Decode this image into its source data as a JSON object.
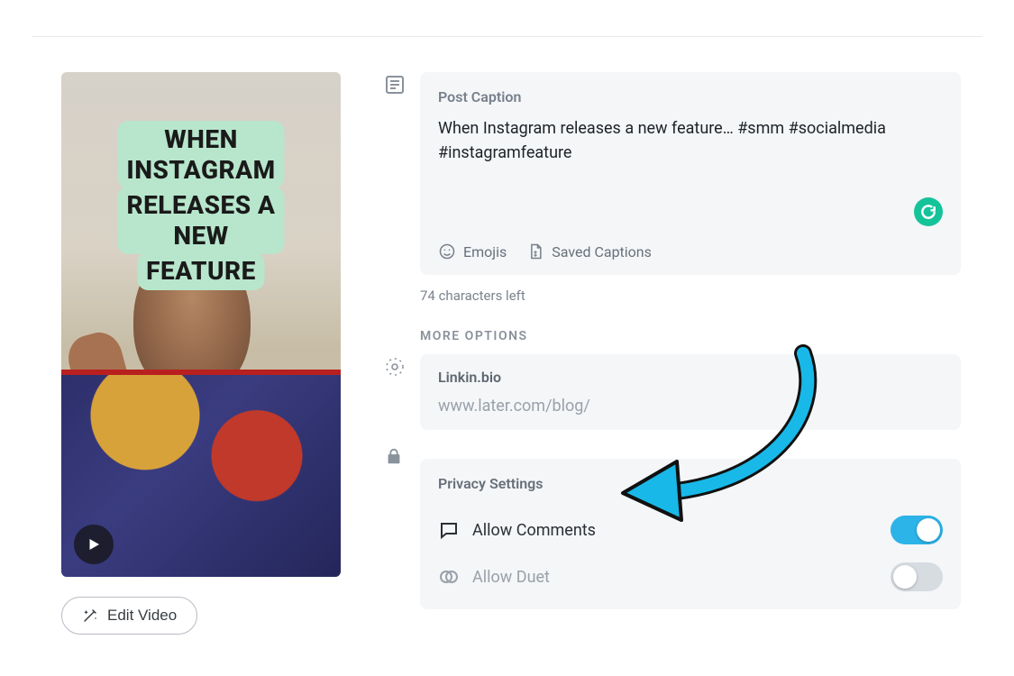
{
  "video": {
    "overlay_line1": "WHEN INSTAGRAM",
    "overlay_line2": "RELEASES A NEW",
    "overlay_line3": "FEATURE",
    "edit_button": "Edit Video"
  },
  "caption": {
    "label": "Post Caption",
    "text": "When Instagram releases a new feature… #smm #socialmedia #instagramfeature",
    "emojis": "Emojis",
    "saved": "Saved Captions",
    "chars_left": "74 characters left"
  },
  "more_options_header": "MORE OPTIONS",
  "linkinbio": {
    "label": "Linkin.bio",
    "url": "www.later.com/blog/"
  },
  "privacy": {
    "label": "Privacy Settings",
    "allow_comments": {
      "label": "Allow Comments",
      "on": true
    },
    "allow_duet": {
      "label": "Allow Duet",
      "on": false
    }
  },
  "colors": {
    "toggle_on": "#2cb3e8",
    "annotation_arrow": "#18b9e8"
  }
}
